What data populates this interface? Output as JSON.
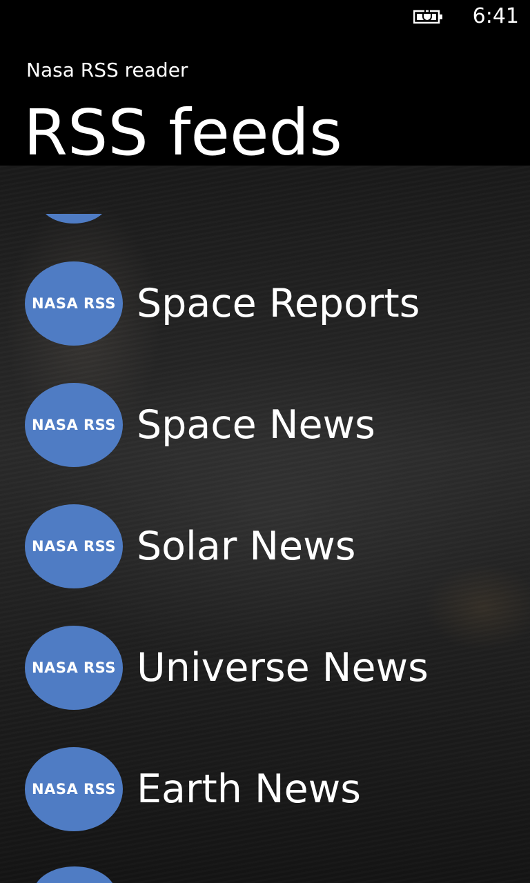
{
  "status_bar": {
    "time": "6:41",
    "battery_icon": "battery-charging-icon"
  },
  "header": {
    "app_title": "Nasa RSS reader",
    "page_title": "RSS feeds"
  },
  "feeds": {
    "logo_text": "NASA RSS",
    "items": [
      {
        "label": "Space Reports"
      },
      {
        "label": "Space News"
      },
      {
        "label": "Solar News"
      },
      {
        "label": "Universe News"
      },
      {
        "label": "Earth News"
      }
    ]
  },
  "colors": {
    "logo_fill": "#4f7cc4",
    "background": "#000000",
    "text": "#ffffff"
  }
}
